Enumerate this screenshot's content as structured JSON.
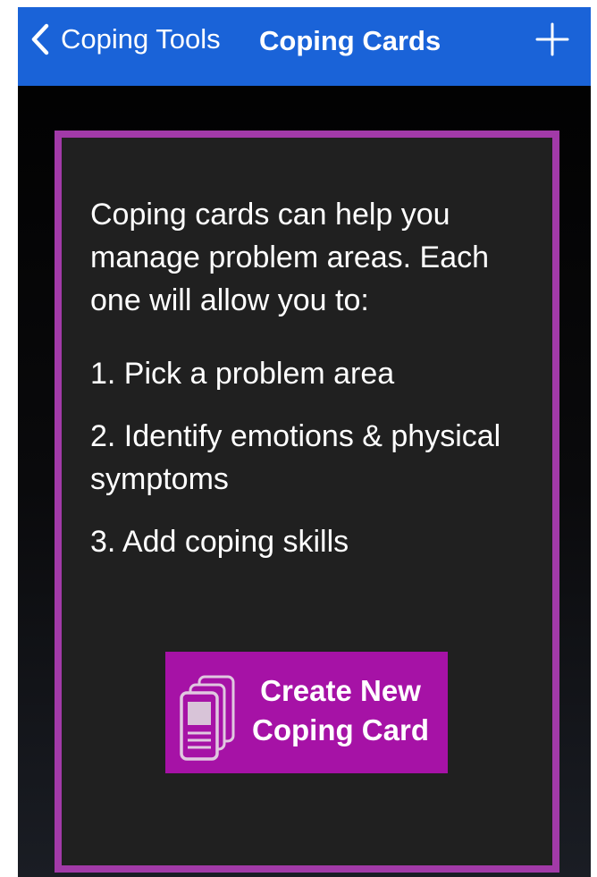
{
  "navbar": {
    "back_label": "Coping Tools",
    "title": "Coping Cards",
    "back_icon": "chevron-left-icon",
    "add_icon": "plus-icon"
  },
  "card": {
    "intro": "Coping cards can help you manage problem areas. Each one will allow you to:",
    "steps": [
      "1. Pick  a problem area",
      "2. Identify emotions & physical symptoms",
      "3. Add coping skills"
    ],
    "create_button": {
      "line1": "Create New",
      "line2": "Coping Card",
      "icon": "coping-card-icon"
    }
  },
  "colors": {
    "navbar": "#1a63d8",
    "card_border": "#a23aa8",
    "card_bg": "#202020",
    "button": "#a612a6"
  }
}
